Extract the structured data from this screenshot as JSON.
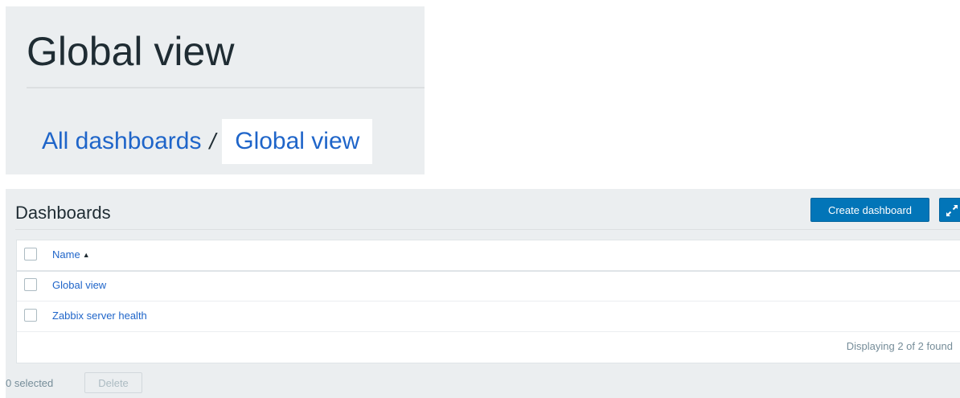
{
  "header": {
    "page_title": "Global view"
  },
  "breadcrumb": {
    "parent": "All dashboards",
    "separator": "/",
    "current": "Global view"
  },
  "dashboards": {
    "title": "Dashboards",
    "create_label": "Create dashboard",
    "fullscreen_icon": "fullscreen-icon",
    "table": {
      "header_name": "Name",
      "sort_indicator": "▲",
      "rows": [
        {
          "name": "Global view"
        },
        {
          "name": "Zabbix server health"
        }
      ]
    },
    "paging": "Displaying 2 of 2 found",
    "selected": "0 selected",
    "delete_label": "Delete"
  },
  "colors": {
    "primary_button": "#0275b8",
    "link": "#1f65c9",
    "panel_bg": "#ebeef0",
    "muted_text": "#768d99"
  }
}
